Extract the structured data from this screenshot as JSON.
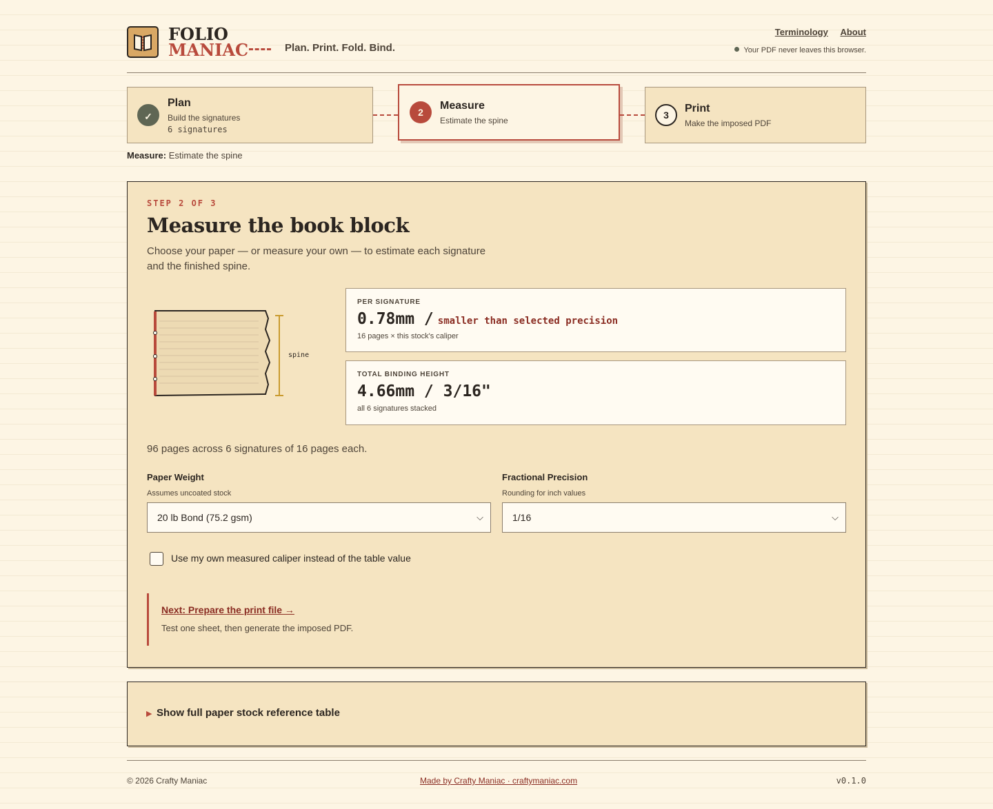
{
  "brand": {
    "line1": "FOLIO",
    "line2": "MANIAC",
    "tagline": "Plan. Print. Fold. Bind."
  },
  "nav": {
    "links": [
      "Terminology",
      "About"
    ],
    "privacy": "Your PDF never leaves this browser."
  },
  "steps": [
    {
      "num": "✓",
      "title": "Plan",
      "sub": "Build the signatures",
      "detail": "6 signatures",
      "state": "done"
    },
    {
      "num": "2",
      "title": "Measure",
      "sub": "Estimate the spine",
      "state": "active"
    },
    {
      "num": "3",
      "title": "Print",
      "sub": "Make the imposed PDF",
      "state": "todo"
    }
  ],
  "crumb": {
    "label": "Measure:",
    "text": "Estimate the spine"
  },
  "main": {
    "kicker": "STEP 2 OF 3",
    "title": "Measure the book block",
    "description": "Choose your paper — or measure your own — to estimate each signature and the finished spine.",
    "illustration_label": "spine",
    "per_signature": {
      "label": "PER SIGNATURE",
      "value": "0.78mm /",
      "note": "smaller than selected precision",
      "foot": "16 pages × this stock's caliper"
    },
    "total": {
      "label": "TOTAL BINDING HEIGHT",
      "value": "4.66mm / 3/16\"",
      "foot": "all 6 signatures stacked"
    },
    "summary": "96 pages across 6 signatures of 16 pages each.",
    "paper_weight": {
      "label": "Paper Weight",
      "help": "Assumes uncoated stock",
      "value": "20 lb Bond (75.2 gsm)"
    },
    "precision": {
      "label": "Fractional Precision",
      "help": "Rounding for inch values",
      "value": "1/16"
    },
    "caliper_checkbox": {
      "label": "Use my own measured caliper instead of the table value",
      "checked": false
    },
    "next": {
      "link": "Next: Prepare the print file →",
      "sub": "Test one sheet, then generate the imposed PDF."
    }
  },
  "reference": {
    "toggle": "Show full paper stock reference table"
  },
  "footer": {
    "copyright": "© 2026 Crafty Maniac",
    "credit": "Made by Crafty Maniac · craftymaniac.com",
    "version": "v0.1.0"
  },
  "colors": {
    "accent": "#b84a3c",
    "done": "#5f6654",
    "panel": "#f5e4c1",
    "background": "#fdf5e4"
  },
  "icons": {
    "logo": "open-book-icon",
    "done": "check-icon",
    "expand": "triangle-right-icon",
    "select": "chevron-down-icon"
  }
}
